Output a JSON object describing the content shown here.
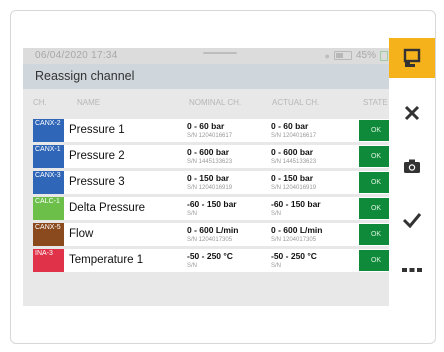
{
  "status_bar": {
    "time": "06/04/2020 17:34",
    "battery": "45%"
  },
  "header": {
    "title": "Reassign channel"
  },
  "columns": {
    "ch": "CH.",
    "name": "NAME",
    "nominal": "NOMINAL CH.",
    "actual": "ACTUAL CH.",
    "state": "STATE"
  },
  "rows": [
    {
      "tag": "CANX-2",
      "color": "#2f66b8",
      "name": "Pressure 1",
      "nominal_range": "0 - 60 bar",
      "nominal_sn": "S/N 1204016617",
      "actual_range": "0 - 60 bar",
      "actual_sn": "S/N 1204016617",
      "state": "OK"
    },
    {
      "tag": "CANX-1",
      "color": "#2f66b8",
      "name": "Pressure 2",
      "nominal_range": "0 - 600 bar",
      "nominal_sn": "S/N 1445133623",
      "actual_range": "0 - 600 bar",
      "actual_sn": "S/N 1445133623",
      "state": "OK"
    },
    {
      "tag": "CANX-3",
      "color": "#2f66b8",
      "name": "Pressure 3",
      "nominal_range": "0 - 150 bar",
      "nominal_sn": "S/N 1204016919",
      "actual_range": "0 - 150 bar",
      "actual_sn": "S/N 1204016919",
      "state": "OK"
    },
    {
      "tag": "CALC-1",
      "color": "#6cc04a",
      "name": "Delta Pressure",
      "nominal_range": "-60 - 150 bar",
      "nominal_sn": "S/N",
      "actual_range": "-60 - 150 bar",
      "actual_sn": "S/N",
      "state": "OK"
    },
    {
      "tag": "CANX-5",
      "color": "#8b4a1e",
      "name": "Flow",
      "nominal_range": "0 - 600 L/min",
      "nominal_sn": "S/N 1204017305",
      "actual_range": "0 - 600 L/min",
      "actual_sn": "S/N 1204017305",
      "state": "OK"
    },
    {
      "tag": "INA-3",
      "color": "#e0334a",
      "name": "Temperature 1",
      "nominal_range": "-50 - 250 °C",
      "nominal_sn": "S/N",
      "actual_range": "-50 - 250 °C",
      "actual_sn": "S/N",
      "state": "OK"
    }
  ],
  "sidebar": {
    "icons": [
      "reassign-icon",
      "close-icon",
      "camera-icon",
      "check-icon",
      "more-icon"
    ],
    "accent": "#f5b21b"
  },
  "colors": {
    "state_ok": "#0f8a3a",
    "header_bg": "#cfd6dc"
  }
}
